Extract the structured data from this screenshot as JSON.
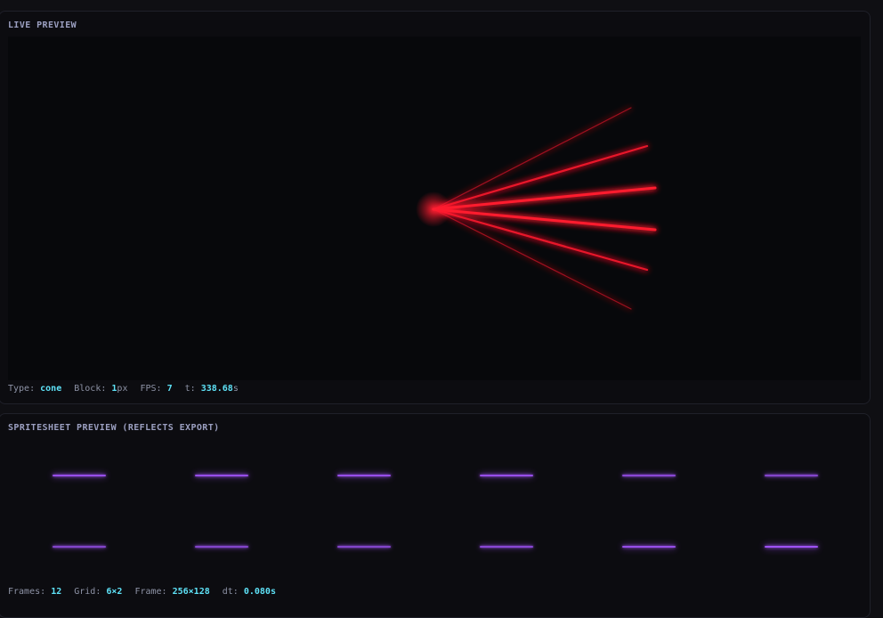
{
  "live": {
    "title": "LIVE PREVIEW",
    "beam_color": "#ff1a2e",
    "stats": {
      "type_label": "Type:",
      "type_value": "cone",
      "block_label": "Block:",
      "block_value": "1",
      "block_unit": "px",
      "fps_label": "FPS:",
      "fps_value": "7",
      "t_label": "t:",
      "t_value": "338.68",
      "t_unit": "s"
    }
  },
  "spritesheet": {
    "title": "SPRITESHEET PREVIEW (REFLECTS EXPORT)",
    "line_color": "#a555ff",
    "frame_intensities": [
      0.8,
      0.8,
      0.8,
      0.8,
      0.6,
      0.5,
      0.5,
      0.5,
      0.5,
      0.6,
      0.8,
      0.9
    ],
    "stats": {
      "frames_label": "Frames:",
      "frames_value": "12",
      "grid_label": "Grid:",
      "grid_value": "6×2",
      "frame_label": "Frame:",
      "frame_value": "256×128",
      "dt_label": "dt:",
      "dt_value": "0.080s"
    }
  }
}
